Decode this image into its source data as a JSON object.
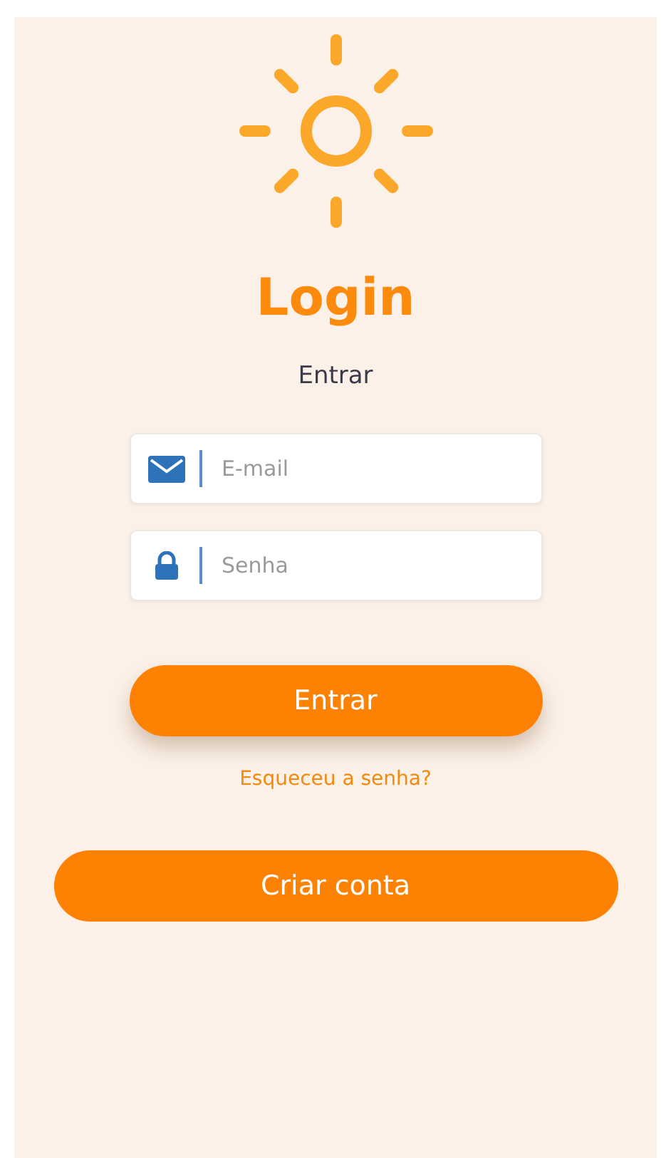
{
  "title": "Login",
  "subtitle": "Entrar",
  "fields": [
    {
      "kind": "email",
      "placeholder": "E-mail"
    },
    {
      "kind": "password",
      "placeholder": "Senha"
    }
  ],
  "submit_button": "Entrar",
  "forgot_link": "Esqueceu a senha?",
  "create_button": "Criar conta"
}
